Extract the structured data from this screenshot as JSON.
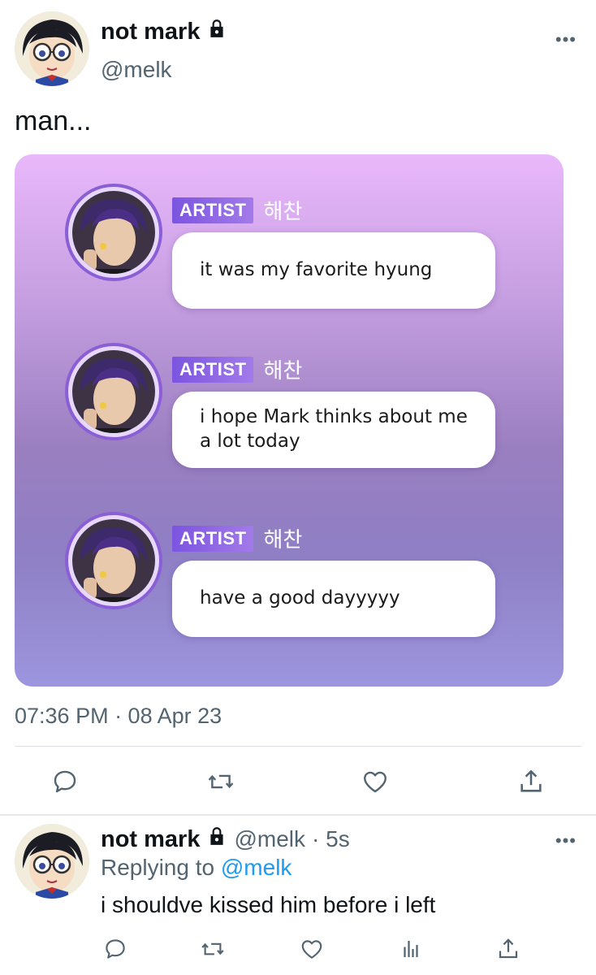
{
  "tweet": {
    "author_name": "not mark",
    "author_handle": "@melk",
    "text": "man...",
    "timestamp": "07:36 PM · 08 Apr 23",
    "more_icon": "more-dots-icon",
    "lock_icon": "lock-icon"
  },
  "card": {
    "messages": [
      {
        "badge": "ARTIST",
        "artist_name": "해찬",
        "text": "it was my favorite hyung"
      },
      {
        "badge": "ARTIST",
        "artist_name": "해찬",
        "text": "i hope Mark thinks about me a lot today"
      },
      {
        "badge": "ARTIST",
        "artist_name": "해찬",
        "text": "have a good dayyyyy"
      }
    ]
  },
  "actions": {
    "reply_icon": "reply-icon",
    "retweet_icon": "retweet-icon",
    "like_icon": "like-icon",
    "share_icon": "share-icon",
    "views_icon": "views-icon"
  },
  "reply": {
    "author_name": "not mark",
    "author_handle": "@melk",
    "time": "· 5s",
    "replying_prefix": "Replying to",
    "replying_to": "@melk",
    "text": "i shouldve kissed him before i left"
  },
  "colors": {
    "accent": "#1d9bf0",
    "secondary_text": "#536471",
    "badge": "#8a5fd6"
  }
}
